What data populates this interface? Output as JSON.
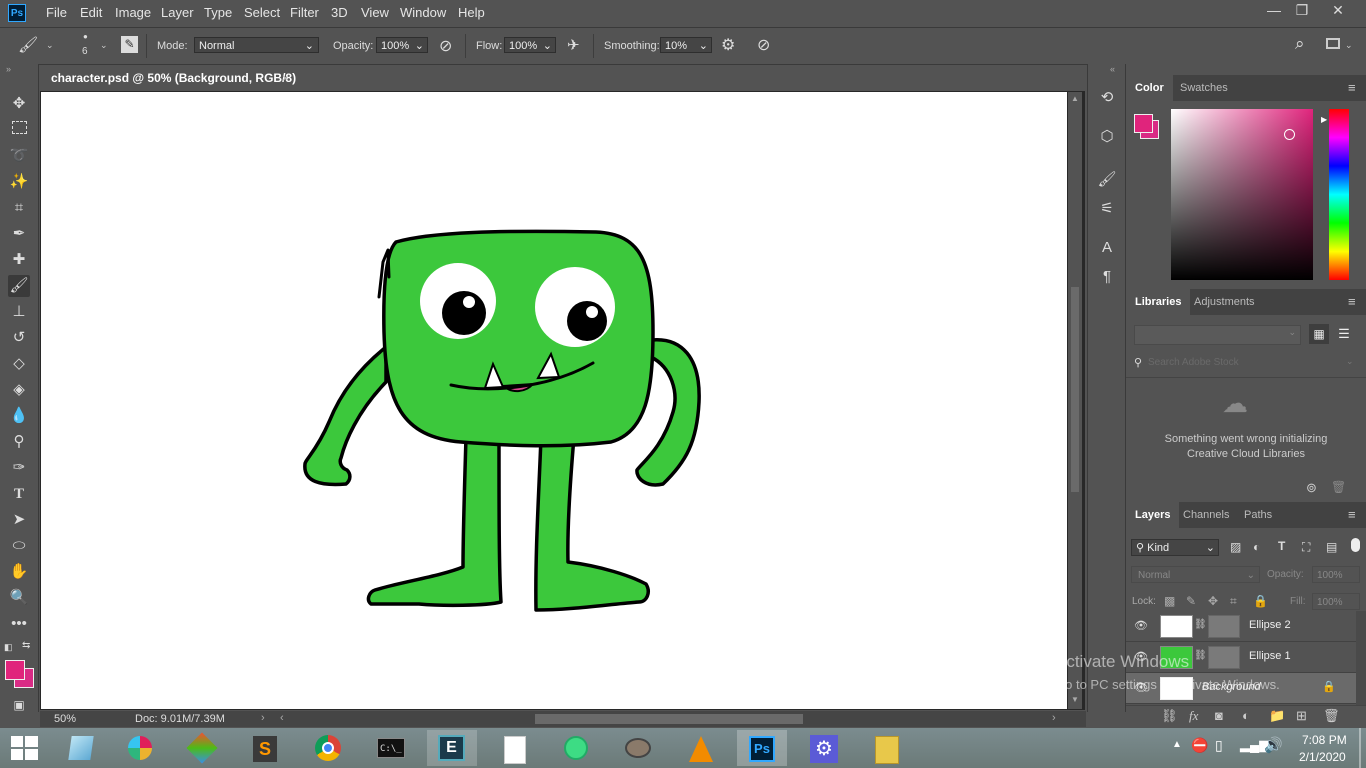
{
  "menubar": {
    "logo": "Ps",
    "items": [
      "File",
      "Edit",
      "Image",
      "Layer",
      "Type",
      "Select",
      "Filter",
      "3D",
      "View",
      "Window",
      "Help"
    ],
    "window_controls": [
      "—",
      "❐",
      "✕"
    ]
  },
  "options": {
    "brush_size": "6",
    "mode_label": "Mode:",
    "mode_value": "Normal",
    "opacity_label": "Opacity:",
    "opacity_value": "100%",
    "flow_label": "Flow:",
    "flow_value": "100%",
    "smoothing_label": "Smoothing:",
    "smoothing_value": "10%"
  },
  "document": {
    "tab_title": "character.psd @ 50% (Background, RGB/8)",
    "close": "×"
  },
  "status": {
    "zoom": "50%",
    "doc": "Doc: 9.01M/7.39M"
  },
  "color_panel": {
    "tabs": [
      "Color",
      "Swatches"
    ],
    "foreground": "#e0247c",
    "background": "#d92b85"
  },
  "libraries_panel": {
    "tabs": [
      "Libraries",
      "Adjustments"
    ],
    "search_placeholder": "Search Adobe Stock",
    "error_message": "Something went wrong initializing Creative Cloud Libraries"
  },
  "layers_panel": {
    "tabs": [
      "Layers",
      "Channels",
      "Paths"
    ],
    "filter_kind": "Kind",
    "blend_mode": "Normal",
    "opacity_label": "Opacity:",
    "opacity_value": "100%",
    "lock_label": "Lock:",
    "fill_label": "Fill:",
    "fill_value": "100%",
    "layers": [
      {
        "name": "Ellipse 2",
        "thumb_color": "#ffffff"
      },
      {
        "name": "Ellipse 1",
        "thumb_color": "#3cc83c"
      },
      {
        "name": "Background",
        "thumb_color": "#ffffff"
      }
    ]
  },
  "watermark": {
    "title": "Activate Windows",
    "subtitle": "Go to PC settings to activate Windows."
  },
  "taskbar": {
    "time": "7:08 PM",
    "date": "2/1/2020"
  }
}
